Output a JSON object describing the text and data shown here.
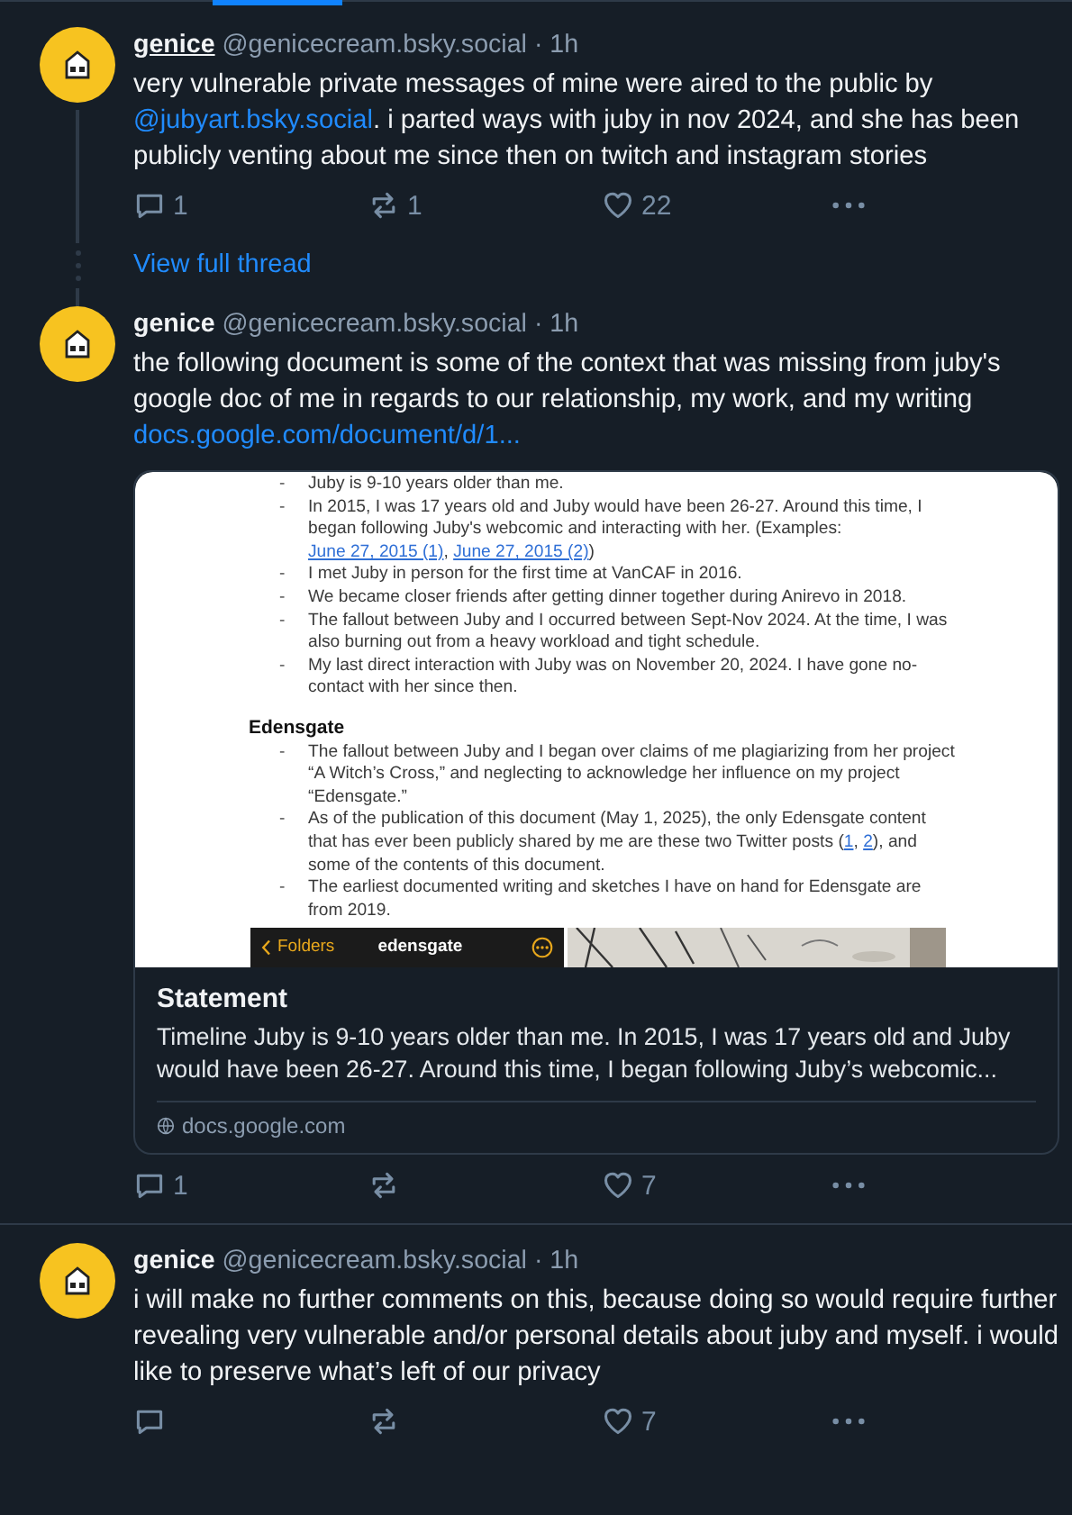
{
  "feed": [
    {
      "kind": "post",
      "author": "genice",
      "author_hovered": true,
      "handle_time": "@genicecream.bsky.social · 1h",
      "line_below": true,
      "line_above": false,
      "divider": false,
      "text": [
        {
          "kind": "text",
          "text": "very vulnerable private messages of mine were aired to the public by "
        },
        {
          "kind": "link",
          "text": "@jubyart.bsky.social"
        },
        {
          "kind": "text",
          "text": ". i parted ways with juby in nov 2024, and she has been publicly venting about me since then on twitch and instagram stories"
        }
      ],
      "actions": [
        {
          "kind": "reply",
          "count": "1"
        },
        {
          "kind": "repost",
          "count": "1"
        },
        {
          "kind": "like",
          "count": "22"
        },
        {
          "kind": "more"
        }
      ]
    },
    {
      "kind": "view_thread",
      "label": "View full thread"
    },
    {
      "kind": "post",
      "author": "genice",
      "author_hovered": false,
      "handle_time": "@genicecream.bsky.social · 1h",
      "line_below": false,
      "line_above": true,
      "divider": false,
      "text": [
        {
          "kind": "text",
          "text": "the following document is some of the context that was missing from juby's google doc of me in regards to our relationship, my work, and my writing "
        },
        {
          "kind": "link",
          "text": "docs.google.com/document/d/1..."
        }
      ],
      "embed": {
        "title": "Statement",
        "description": "Timeline Juby is 9-10 years older than me. In 2015, I was 17 years old and Juby would have been 26-27. Around this time, I began following Juby’s webcomic...",
        "domain": "docs.google.com",
        "preview": {
          "blocks": [
            {
              "kind": "bullet",
              "marker": "-",
              "segments": [
                {
                  "kind": "text",
                  "text": "Juby is 9-10 years older than me."
                }
              ]
            },
            {
              "kind": "bullet",
              "marker": "-",
              "segments": [
                {
                  "kind": "text",
                  "text": "In 2015, I was 17 years old and Juby would have been 26-27. Around this time, I began following Juby's webcomic and interacting with her. (Examples: "
                },
                {
                  "kind": "link",
                  "text": "June 27, 2015 (1)"
                },
                {
                  "kind": "text",
                  "text": ", "
                },
                {
                  "kind": "link",
                  "text": "June 27, 2015 (2)"
                },
                {
                  "kind": "text",
                  "text": ")"
                }
              ]
            },
            {
              "kind": "bullet",
              "marker": "-",
              "segments": [
                {
                  "kind": "text",
                  "text": "I met Juby in person for the first time at VanCAF in 2016."
                }
              ]
            },
            {
              "kind": "bullet",
              "marker": "-",
              "segments": [
                {
                  "kind": "text",
                  "text": "We became closer friends after getting dinner together during Anirevo in 2018."
                }
              ]
            },
            {
              "kind": "bullet",
              "marker": "-",
              "segments": [
                {
                  "kind": "text",
                  "text": "The fallout between Juby and I occurred between Sept-Nov 2024. At the time, I was also burning out from a heavy workload and tight schedule."
                }
              ]
            },
            {
              "kind": "bullet",
              "marker": "-",
              "segments": [
                {
                  "kind": "text",
                  "text": "My last direct interaction with Juby was on November 20, 2024. I have gone no-contact with her since then."
                }
              ]
            },
            {
              "kind": "heading",
              "text": "Edensgate"
            },
            {
              "kind": "bullet",
              "marker": "-",
              "segments": [
                {
                  "kind": "text",
                  "text": "The fallout between Juby and I began over claims of me plagiarizing from her project “A Witch’s Cross,” and neglecting to acknowledge her influence on my project “Edensgate.”"
                }
              ]
            },
            {
              "kind": "bullet",
              "marker": "-",
              "segments": [
                {
                  "kind": "text",
                  "text": "As of the publication of this document (May 1, 2025), the only Edensgate content that has ever been publicly shared by me are these two Twitter posts ("
                },
                {
                  "kind": "link",
                  "text": "1"
                },
                {
                  "kind": "text",
                  "text": ", "
                },
                {
                  "kind": "link",
                  "text": "2"
                },
                {
                  "kind": "text",
                  "text": "), and some of the contents of this document."
                }
              ]
            },
            {
              "kind": "bullet",
              "marker": "-",
              "segments": [
                {
                  "kind": "text",
                  "text": "The earliest documented writing and sketches I have on hand for Edensgate are from 2019."
                }
              ]
            }
          ],
          "strip": {
            "back": "Folders",
            "title": "edensgate"
          }
        }
      },
      "actions": [
        {
          "kind": "reply",
          "count": "1"
        },
        {
          "kind": "repost"
        },
        {
          "kind": "like",
          "count": "7"
        },
        {
          "kind": "more"
        }
      ]
    },
    {
      "kind": "post",
      "author": "genice",
      "author_hovered": false,
      "handle_time": "@genicecream.bsky.social · 1h",
      "line_below": false,
      "line_above": false,
      "divider": true,
      "text": [
        {
          "kind": "text",
          "text": "i will make no further comments on this, because doing so would require further revealing very vulnerable and/or personal details about juby and myself. i would like to preserve what’s left of our privacy"
        }
      ],
      "actions": [
        {
          "kind": "reply"
        },
        {
          "kind": "repost"
        },
        {
          "kind": "like",
          "count": "7"
        },
        {
          "kind": "more"
        }
      ]
    }
  ]
}
